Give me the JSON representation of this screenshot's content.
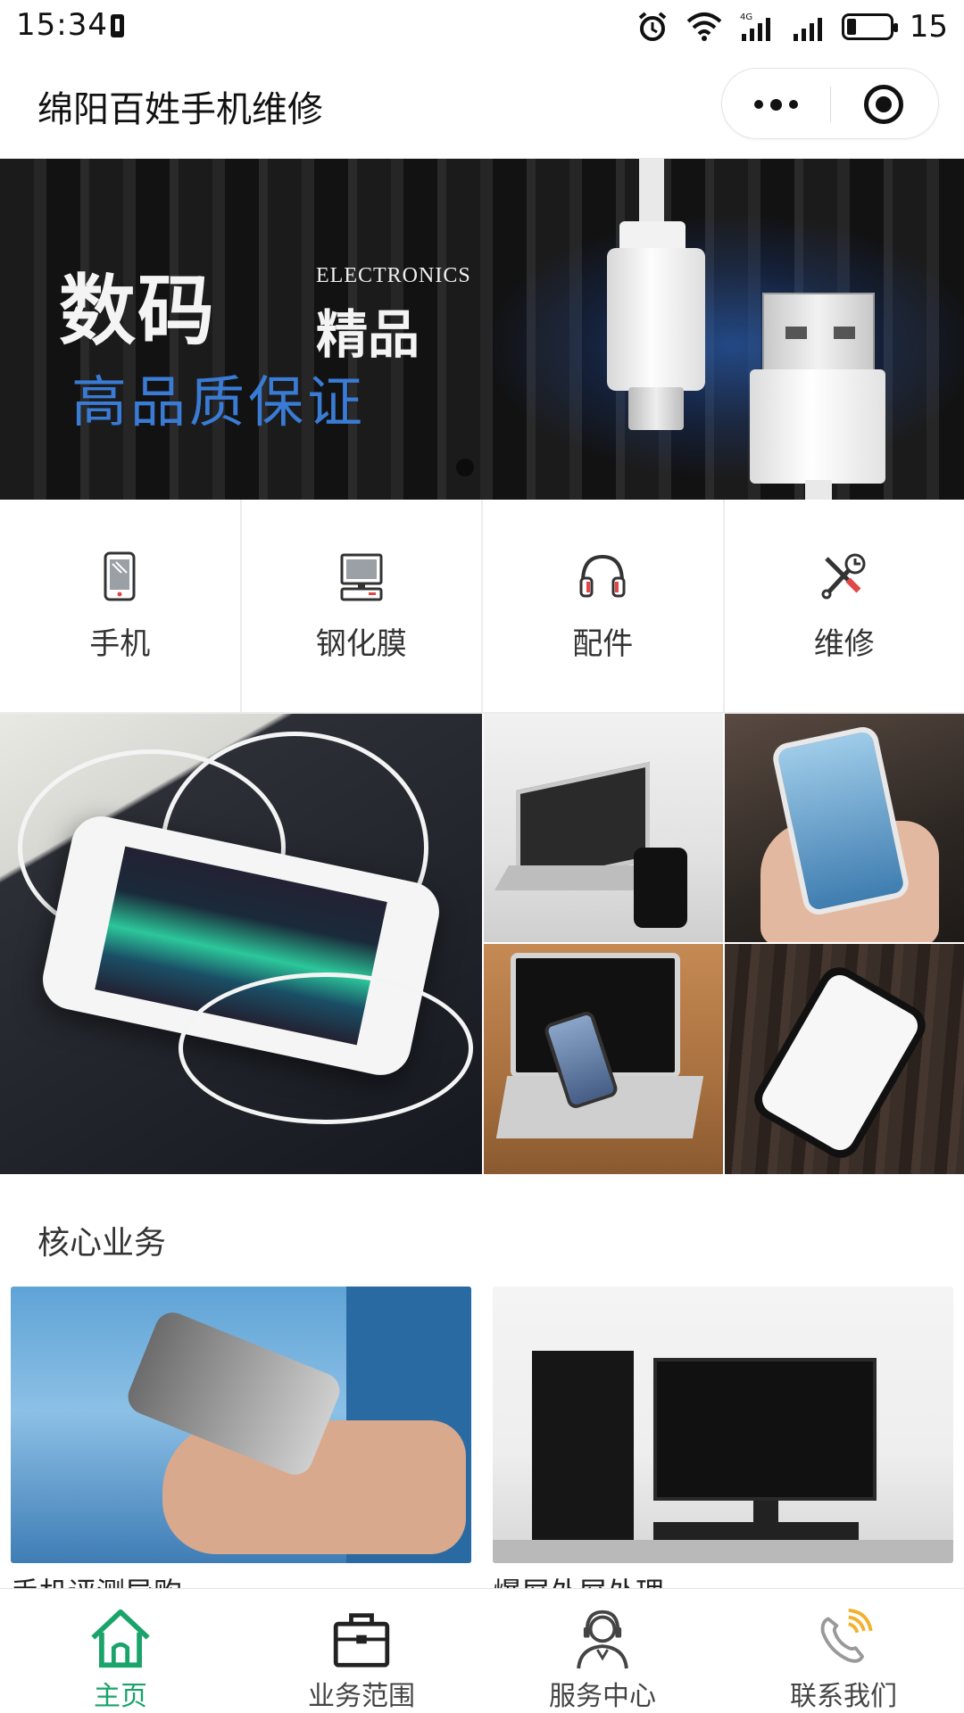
{
  "status_bar": {
    "time": "15:34",
    "battery_level": "15",
    "icons": [
      "battery-saver-icon",
      "alarm-icon",
      "wifi-icon",
      "signal-4g-icon",
      "signal-icon",
      "battery-icon"
    ]
  },
  "header": {
    "title": "绵阳百姓手机维修",
    "more_icon": "more-dots-icon",
    "close_icon": "target-close-icon"
  },
  "banner": {
    "title": "数码",
    "title_suffix": "精品",
    "english": "ELECTRONICS",
    "subtitle": "高品质保证",
    "accent_color": "#3a7bd5"
  },
  "categories": [
    {
      "label": "手机",
      "icon": "phone-icon"
    },
    {
      "label": "钢化膜",
      "icon": "computer-icon"
    },
    {
      "label": "配件",
      "icon": "headphones-icon"
    },
    {
      "label": "维修",
      "icon": "tools-icon"
    }
  ],
  "section": {
    "title": "核心业务"
  },
  "cards": [
    {
      "label": "手机评测导购"
    },
    {
      "label": "爆屏外屏处理"
    }
  ],
  "tabbar": {
    "active_color": "#1aa36b",
    "items": [
      {
        "label": "主页",
        "icon": "home-icon",
        "active": true
      },
      {
        "label": "业务范围",
        "icon": "briefcase-icon",
        "active": false
      },
      {
        "label": "服务中心",
        "icon": "support-agent-icon",
        "active": false
      },
      {
        "label": "联系我们",
        "icon": "phone-call-icon",
        "active": false
      }
    ]
  }
}
